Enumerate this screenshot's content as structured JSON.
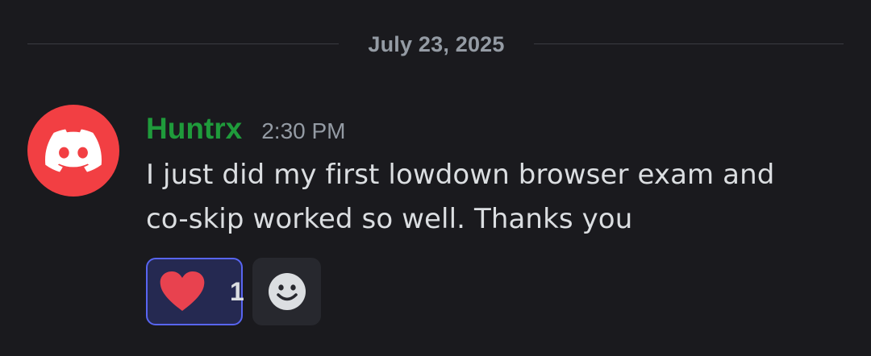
{
  "divider": {
    "date": "July 23, 2025"
  },
  "message": {
    "username": "Huntrx",
    "username_color": "#1f9b3b",
    "timestamp": "2:30 PM",
    "avatar_icon": "discord-logo-icon",
    "avatar_color": "#f23f43",
    "lines": [
      "I just did my first lowdown browser exam and",
      "co-skip worked so well. Thanks you"
    ]
  },
  "reactions": {
    "items": [
      {
        "emoji": "heart-icon",
        "count": "1",
        "reacted_by_me": true
      }
    ],
    "add_reaction_icon": "smiley-face-icon"
  },
  "colors": {
    "background": "#1a1a1e",
    "accent": "#5865f2",
    "heart": "#e8424f"
  }
}
